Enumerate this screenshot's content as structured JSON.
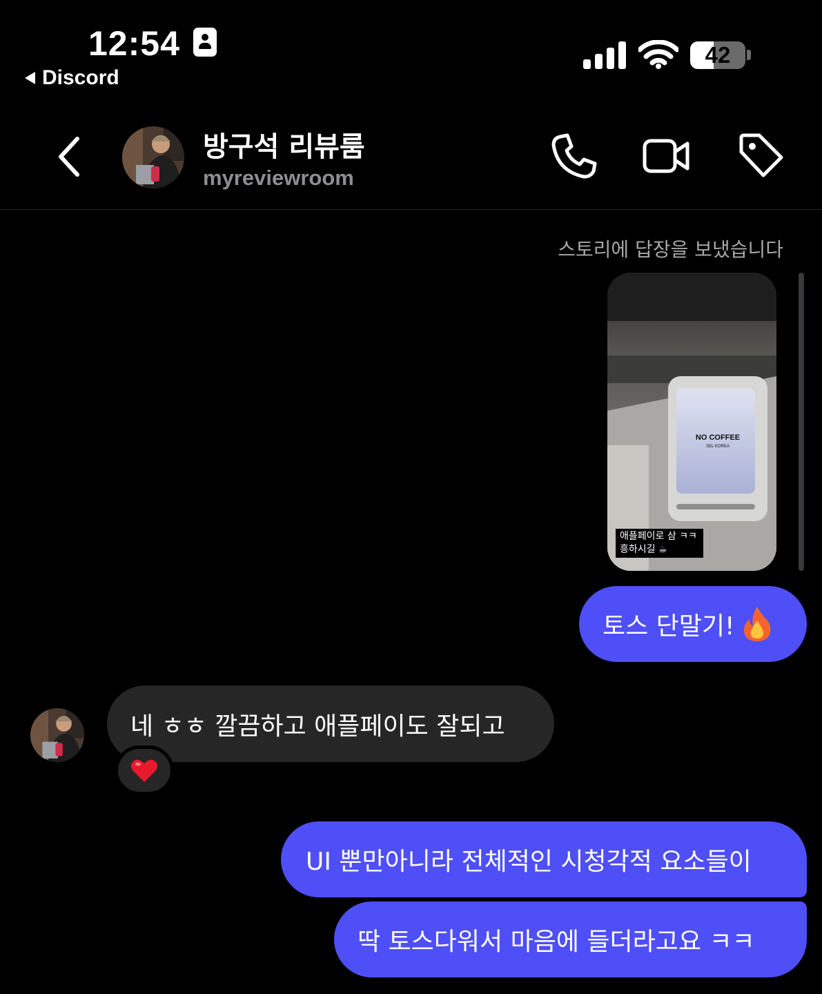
{
  "status_bar": {
    "time": "12:54",
    "back_app": "Discord",
    "battery_level": "42",
    "battery_fraction": 0.42
  },
  "header": {
    "name": "방구석 리뷰룸",
    "username": "myreviewroom",
    "icons": [
      "back-chevron-icon",
      "phone-icon",
      "video-camera-icon",
      "tag-icon"
    ]
  },
  "messages": {
    "story_reply_note": "스토리에 답장을 보냈습니다",
    "story_caption_line1": "애플페이로 삼 ㅋㅋ",
    "story_caption_line2": "흥하시길 ☕",
    "story_sign_text": "NO COFFEE",
    "story_sign_sub": "SEL KOREA",
    "msg1": "토스 단말기!",
    "msg1_emoji": "fire",
    "msg2": "네 ㅎㅎ 깔끔하고 애플페이도 잘되고",
    "msg2_reaction": "heart",
    "msg3": "UI 뿐만아니라 전체적인 시청각적 요소들이",
    "msg4": "딱 토스다워서 마음에 들더라고요 ㅋㅋ"
  },
  "colors": {
    "background": "#000000",
    "outgoing_bubble": "#4f4ff7",
    "incoming_bubble": "#262626",
    "secondary_text": "#8e8e93",
    "reaction_heart": "#e8192c"
  }
}
